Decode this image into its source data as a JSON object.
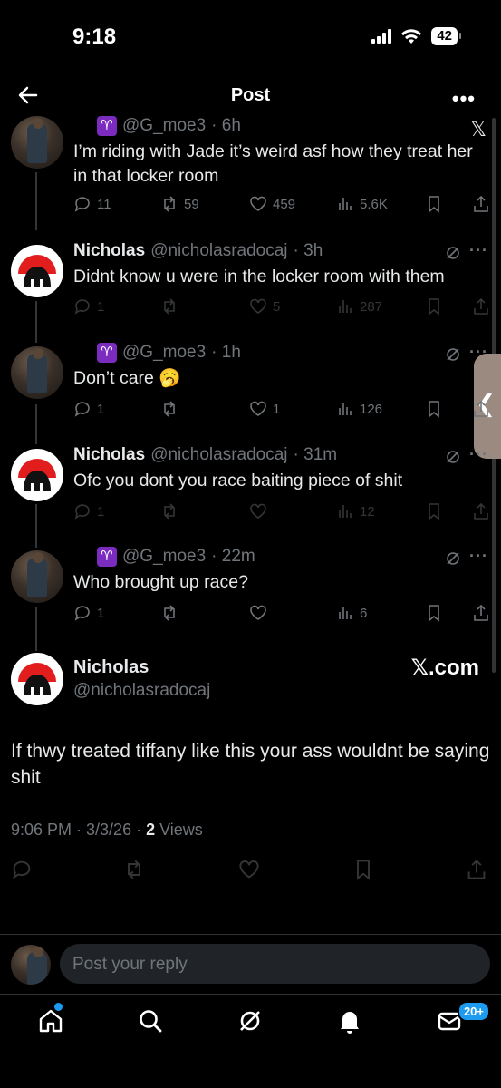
{
  "status": {
    "time": "9:18",
    "battery": "42"
  },
  "topbar": {
    "title": "Post"
  },
  "replies": [
    {
      "handle": "@G_moe3",
      "time": "· 6h",
      "text": "I’m riding with Jade it’s weird asf how they treat her in that locker room",
      "replies": "11",
      "reposts": "59",
      "likes": "459",
      "views": "5.6K"
    },
    {
      "name": "Nicholas",
      "handle": "@nicholasradocaj",
      "time": "· 3h",
      "text": "Didnt know u were in the locker room with them",
      "replies": "1",
      "reposts": "",
      "likes": "5",
      "views": "287"
    },
    {
      "handle": "@G_moe3",
      "time": "· 1h",
      "text": "Don’t care 🥱",
      "replies": "1",
      "reposts": "",
      "likes": "1",
      "views": "126"
    },
    {
      "name": "Nicholas",
      "handle": "@nicholasradocaj",
      "time": "· 31m",
      "text": "Ofc you dont you race baiting piece of shit",
      "replies": "1",
      "reposts": "",
      "likes": "",
      "views": "12"
    },
    {
      "handle": "@G_moe3",
      "time": "· 22m",
      "text": "Who brought up race?",
      "replies": "1",
      "reposts": "",
      "likes": "",
      "views": "6"
    }
  ],
  "main_post": {
    "name": "Nicholas",
    "handle": "@nicholasradocaj",
    "brand": "𝕏.com",
    "text": "If thwy treated tiffany like this your ass wouldnt be saying shit",
    "timestamp": "9:06 PM · 3/3/26 · ",
    "views_count": "2",
    "views_label": " Views"
  },
  "reply_box": {
    "placeholder": "Post your reply"
  },
  "tabbar": {
    "messages_badge": "20+"
  },
  "icons": [
    "back-arrow-icon",
    "more-icon",
    "x-logo-icon",
    "reply-icon",
    "repost-icon",
    "like-icon",
    "views-icon",
    "bookmark-icon",
    "share-icon",
    "grok-icon",
    "home-icon",
    "search-icon",
    "bell-icon",
    "mail-icon"
  ],
  "colors": {
    "background": "#000000",
    "accent": "#1d9bf0",
    "muted": "#71767b",
    "text": "#e7e9ea"
  }
}
